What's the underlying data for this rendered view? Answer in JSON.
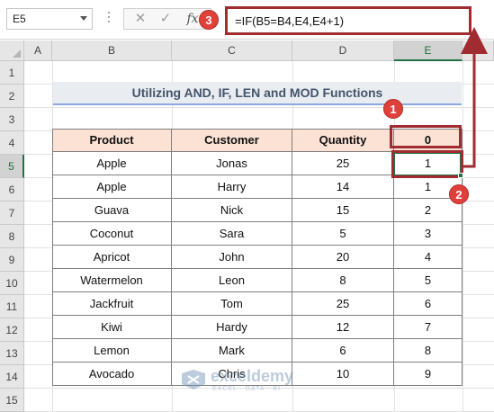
{
  "formula_bar": {
    "name_box": "E5",
    "cancel_glyph": "✕",
    "enter_glyph": "✓",
    "fx_label": "fx",
    "formula": "=IF(B5=B4,E4,E4+1)"
  },
  "columns": [
    "A",
    "B",
    "C",
    "D",
    "E"
  ],
  "rows": [
    "1",
    "2",
    "3",
    "4",
    "5",
    "6",
    "7",
    "8",
    "9",
    "10",
    "11",
    "12",
    "13",
    "14",
    "15"
  ],
  "selected_cell": {
    "column": "E",
    "row": "5"
  },
  "title": "Utilizing AND, IF, LEN and MOD Functions",
  "table": {
    "headers": [
      "Product",
      "Customer",
      "Quantity",
      "0"
    ],
    "rows": [
      [
        "Apple",
        "Jonas",
        "25",
        "1"
      ],
      [
        "Apple",
        "Harry",
        "14",
        "1"
      ],
      [
        "Guava",
        "Nick",
        "15",
        "2"
      ],
      [
        "Coconut",
        "Sara",
        "5",
        "3"
      ],
      [
        "Apricot",
        "John",
        "20",
        "4"
      ],
      [
        "Watermelon",
        "Leon",
        "8",
        "5"
      ],
      [
        "Jackfruit",
        "Tom",
        "25",
        "6"
      ],
      [
        "Kiwi",
        "Hardy",
        "12",
        "7"
      ],
      [
        "Lemon",
        "Mark",
        "6",
        "8"
      ],
      [
        "Avocado",
        "Chris",
        "10",
        "9"
      ]
    ]
  },
  "badges": [
    "1",
    "2",
    "3"
  ],
  "watermark": {
    "name": "exceldemy",
    "tagline": "EXCEL · DATA · BI"
  },
  "colors": {
    "header_fill": "#fbe2d5",
    "title_fill": "#e9edf2",
    "callout": "#a02b31",
    "badge": "#e0403a",
    "selection": "#217346"
  }
}
